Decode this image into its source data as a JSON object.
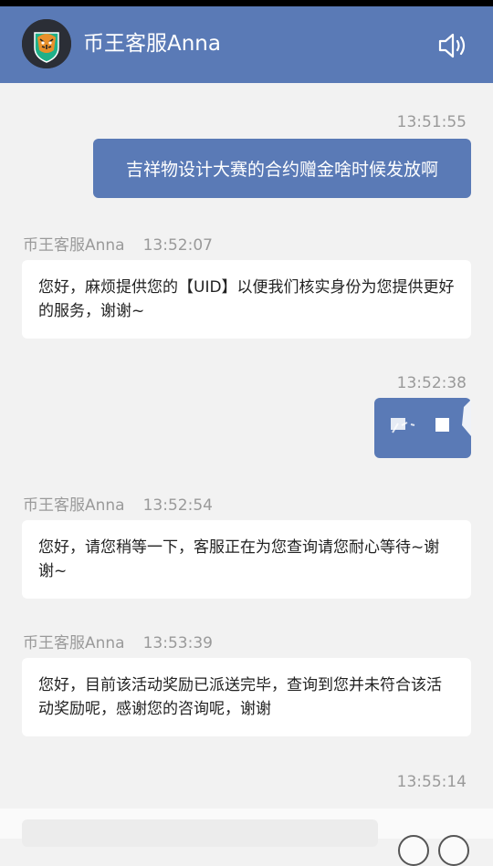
{
  "header": {
    "title": "币王客服Anna",
    "avatar_icon": "tiger-logo-icon",
    "sound_icon": "speaker-icon"
  },
  "messages": {
    "m1": {
      "time": "13:51:55",
      "text": "吉祥物设计大赛的合约赠金啥时候发放啊"
    },
    "m2": {
      "sender": "币王客服Anna",
      "time": "13:52:07",
      "text": "您好，麻烦提供您的【UID】以便我们核实身份为您提供更好的服务，谢谢~"
    },
    "m3": {
      "time": "13:52:38",
      "content": "image-thumbnail"
    },
    "m4": {
      "sender": "币王客服Anna",
      "time": "13:52:54",
      "text": "您好，请您稍等一下，客服正在为您查询请您耐心等待~谢谢~"
    },
    "m5": {
      "sender": "币王客服Anna",
      "time": "13:53:39",
      "text": "您好，目前该活动奖励已派送完毕，查询到您并未符合该活动奖励呢，感谢您的咨询呢，谢谢"
    },
    "m6": {
      "time": "13:55:14"
    }
  },
  "colors": {
    "header_bg": "#5a7ab6",
    "outgoing_bubble": "#5a7ab6",
    "incoming_bubble": "#ffffff",
    "page_bg": "#f2f2f2"
  }
}
